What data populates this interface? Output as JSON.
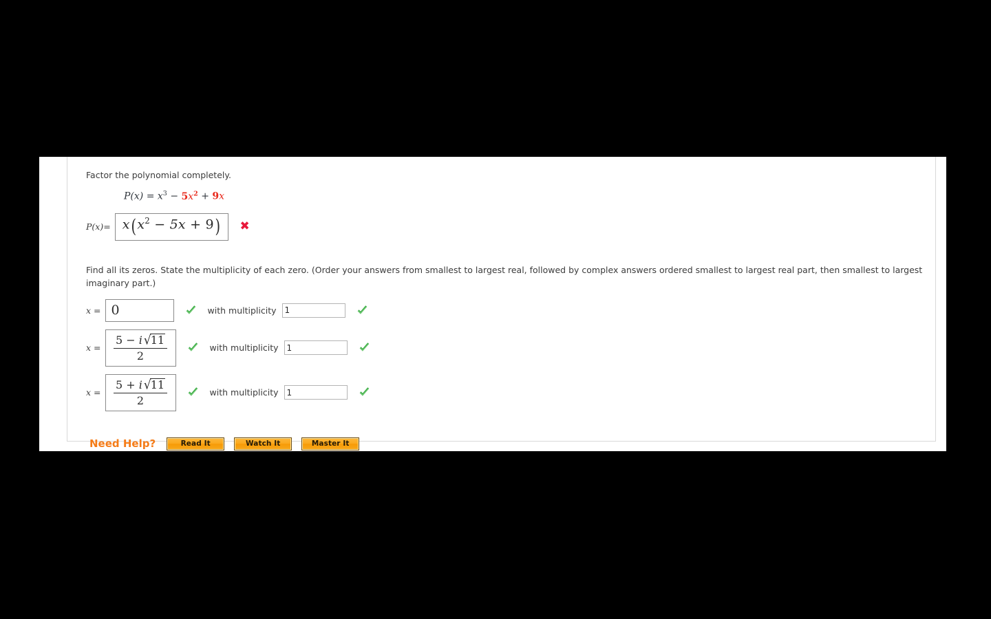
{
  "question": {
    "prompt": "Factor the polynomial completely.",
    "polynomial": {
      "lhs": "P(x)",
      "equals": "=",
      "term1_base": "x",
      "term1_exp": "3",
      "op1": "−",
      "term2_coef": "5",
      "term2_base": "x",
      "term2_exp": "2",
      "op2": "+",
      "term3_coef": "9",
      "term3_base": "x",
      "red_color": "#e8291c"
    },
    "answer_row": {
      "label_lhs": "P(x)",
      "label_equals": "=",
      "value_outer_var": "x",
      "value_paren_open": "(",
      "value_inner_base": "x",
      "value_inner_exp": "2",
      "value_inner_op1": "−",
      "value_inner_term2": "5x",
      "value_inner_op2": "+",
      "value_inner_term3": "9",
      "value_paren_close": ")",
      "value_plain": "x(x^2 - 5x + 9)",
      "status": "incorrect",
      "status_glyph": "✖",
      "status_color": "#e8193c"
    }
  },
  "zeros_section": {
    "instructions": "Find all its zeros. State the multiplicity of each zero. (Order your answers from smallest to largest real, followed by complex answers ordered smallest to largest real part, then smallest to largest imaginary part.)",
    "x_label": "x",
    "equals": "=",
    "multiplicity_label": "with multiplicity",
    "rows": [
      {
        "value_kind": "plain",
        "value_plain": "0",
        "value_status": "correct",
        "multiplicity_value": "1",
        "multiplicity_status": "correct"
      },
      {
        "value_kind": "fraction",
        "num_lead": "5",
        "num_op": "−",
        "num_i": "i",
        "num_radicand": "11",
        "denominator": "2",
        "value_plain": "(5 - i√11)/2",
        "value_status": "correct",
        "multiplicity_value": "1",
        "multiplicity_status": "correct"
      },
      {
        "value_kind": "fraction",
        "num_lead": "5",
        "num_op": "+",
        "num_i": "i",
        "num_radicand": "11",
        "denominator": "2",
        "value_plain": "(5 + i√11)/2",
        "value_status": "correct",
        "multiplicity_value": "1",
        "multiplicity_status": "correct"
      }
    ]
  },
  "need_help": {
    "title": "Need Help?",
    "title_color": "#f57c18",
    "buttons": [
      {
        "label": "Read It"
      },
      {
        "label": "Watch It"
      },
      {
        "label": "Master It"
      }
    ]
  }
}
